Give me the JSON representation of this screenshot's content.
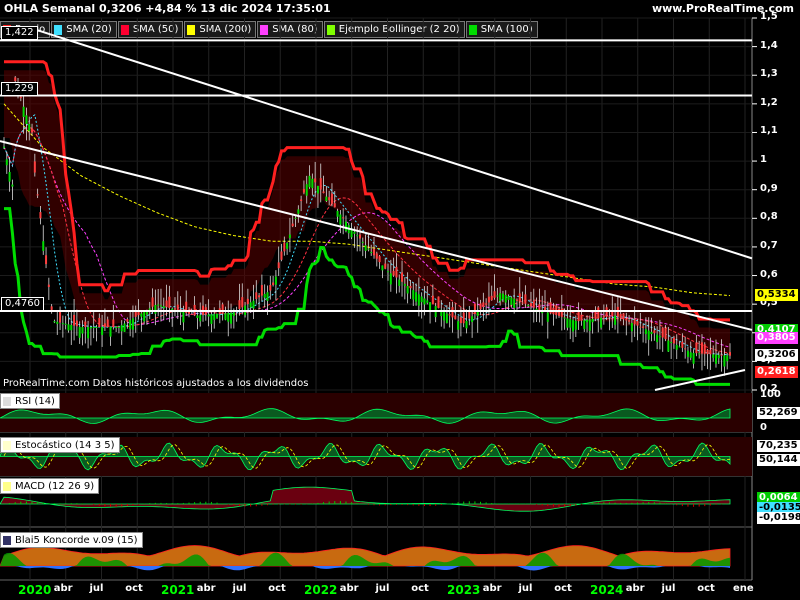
{
  "header": {
    "title": "OHLA Semanal 0,3206 +4,84 % 13 dic 2024 17:35:01",
    "site": "www.ProRealTime.com",
    "credit": "ProRealTime.com  Datos históricos ajustados a los dividendos"
  },
  "legend": [
    {
      "label": "Precio",
      "color": "#ff2020"
    },
    {
      "label": "SMA (20)",
      "color": "#40e0ff"
    },
    {
      "label": "SMA (50)",
      "color": "#ff0030"
    },
    {
      "label": "SMA (200)",
      "color": "#ffff00"
    },
    {
      "label": "SMA (80)",
      "color": "#ff40ff"
    },
    {
      "label": "Ejemplo Bollinger (2 20)",
      "color": "#80ff00"
    },
    {
      "label": "SMA (100)",
      "color": "#00dd00"
    }
  ],
  "levels": [
    {
      "label": "1,422",
      "value": 1.422
    },
    {
      "label": "1,229",
      "value": 1.229
    },
    {
      "label": "0,4760",
      "value": 0.476
    }
  ],
  "price_axis": {
    "ticks": [
      "1,5",
      "1,4",
      "1,3",
      "1,2",
      "1,1",
      "1",
      "0,9",
      "0,8",
      "0,7",
      "0,6",
      "0,5",
      "0,4",
      "0,3",
      "0,2"
    ],
    "badges": [
      {
        "label": "0,5334",
        "value": 0.5334,
        "bg": "#ffff00",
        "fg": "#000"
      },
      {
        "label": "0,4107",
        "value": 0.4107,
        "bg": "#00cc00",
        "fg": "#fff"
      },
      {
        "label": "0,3805",
        "value": 0.3805,
        "bg": "#ff40ff",
        "fg": "#fff"
      },
      {
        "label": "0,3206",
        "value": 0.3206,
        "bg": "#ffffff",
        "fg": "#000"
      },
      {
        "label": "0,2618",
        "value": 0.2618,
        "bg": "#ff2020",
        "fg": "#fff"
      }
    ]
  },
  "x_axis": {
    "labels": [
      "2020",
      "abr",
      "jul",
      "oct",
      "2021",
      "abr",
      "jul",
      "oct",
      "2022",
      "abr",
      "jul",
      "oct",
      "2023",
      "abr",
      "jul",
      "oct",
      "2024",
      "abr",
      "jul",
      "oct",
      "ene"
    ],
    "year_labels": [
      "2020",
      "2021",
      "2022",
      "2023",
      "2024"
    ]
  },
  "panes": {
    "rsi": {
      "label": "RSI (14)",
      "ticks": [
        "100",
        "0"
      ],
      "value": "52,269"
    },
    "stoch": {
      "label": "Estocástico (14 3 5)",
      "values": [
        "70,235",
        "50,144"
      ]
    },
    "macd": {
      "label": "MACD (12 26 9)",
      "values": [
        "0,0064",
        "-0,0135",
        "-0,0198"
      ]
    },
    "koncorde": {
      "label": "Blai5 Koncorde v.09 (15)"
    }
  },
  "colors": {
    "background": "#000000",
    "bull": "#00dd00",
    "bear": "#ff2020",
    "line": "#ffffff"
  },
  "chart_data": {
    "type": "line",
    "title": "OHLA Semanal 0,3206 +4,84 % 13 dic 2024 17:35:01",
    "xlabel": "",
    "ylabel": "",
    "x": [
      "2020",
      "abr",
      "jul",
      "oct",
      "2021",
      "abr",
      "jul",
      "oct",
      "2022",
      "abr",
      "jul",
      "oct",
      "2023",
      "abr",
      "jul",
      "oct",
      "2024",
      "abr",
      "jul",
      "oct"
    ],
    "ylim": [
      0.2,
      1.5
    ],
    "series": [
      {
        "name": "Precio",
        "values": [
          1.05,
          0.45,
          0.42,
          0.42,
          0.5,
          0.46,
          0.47,
          0.55,
          0.95,
          0.78,
          0.62,
          0.52,
          0.43,
          0.54,
          0.48,
          0.44,
          0.46,
          0.4,
          0.33,
          0.32
        ]
      },
      {
        "name": "SMA (200)",
        "values": [
          1.2,
          1.05,
          0.95,
          0.88,
          0.82,
          0.77,
          0.74,
          0.72,
          0.72,
          0.71,
          0.69,
          0.67,
          0.65,
          0.63,
          0.61,
          0.59,
          0.57,
          0.56,
          0.54,
          0.53
        ]
      }
    ],
    "grid": true
  }
}
